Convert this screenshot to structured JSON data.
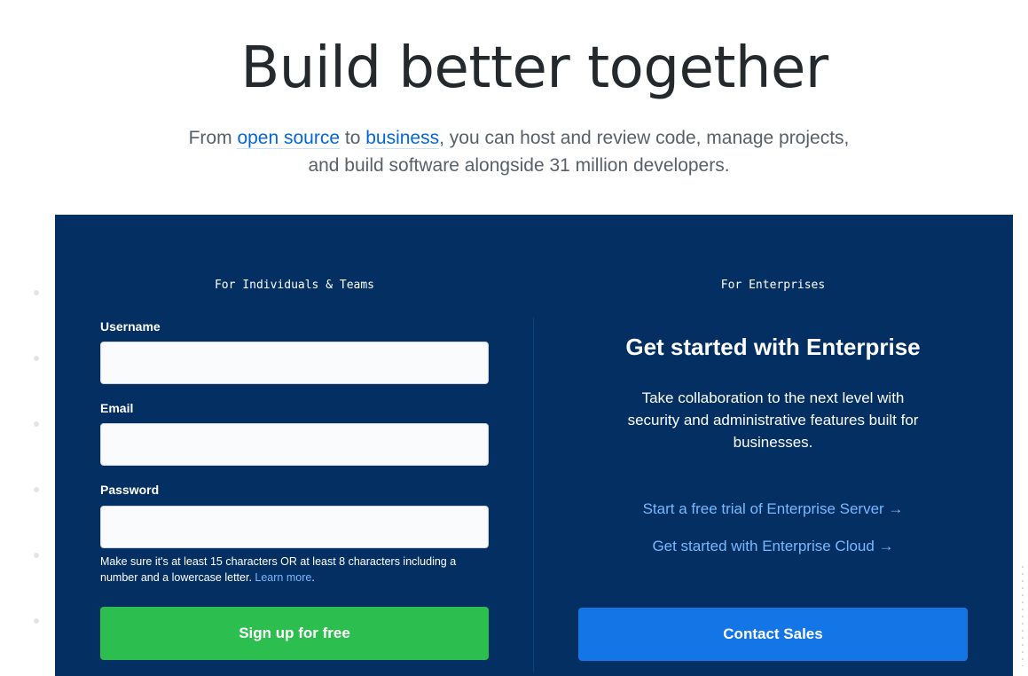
{
  "hero": {
    "title": "Build better together",
    "sub_from": "From ",
    "sub_link1": "open source",
    "sub_to": " to ",
    "sub_link2": "business",
    "sub_rest_line1": ", you can host and review code, manage projects,",
    "sub_line2": "and build software alongside 31 million developers."
  },
  "individuals": {
    "heading": "For Individuals & Teams",
    "username_label": "Username",
    "username_value": "",
    "email_label": "Email",
    "email_value": "",
    "password_label": "Password",
    "password_value": "",
    "hint_text": "Make sure it's at least 15 characters OR at least 8 characters including a number and a lowercase letter. ",
    "hint_link": "Learn more",
    "hint_end": ".",
    "signup_button": "Sign up for free"
  },
  "enterprise": {
    "heading": "For Enterprises",
    "title": "Get started with Enterprise",
    "description": "Take collaboration to the next level with security and administrative features built for businesses.",
    "link_server": "Start a free trial of Enterprise Server →",
    "link_cloud": "Get started with Enterprise Cloud →",
    "contact_button": "Contact Sales"
  },
  "colors": {
    "panel_bg": "#032f62",
    "signup_green": "#2cbe4e",
    "contact_blue": "#1375e6",
    "link_light_blue": "#79b8ff"
  }
}
